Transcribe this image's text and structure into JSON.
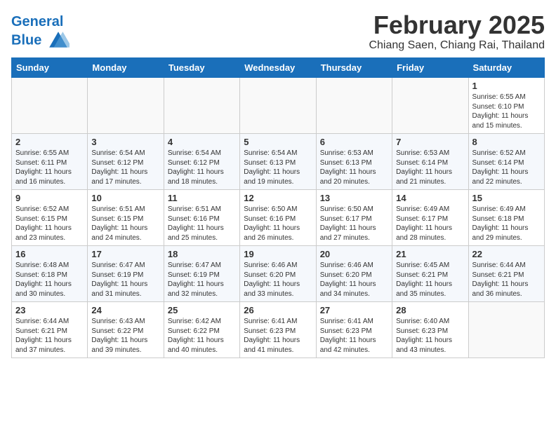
{
  "header": {
    "logo_line1": "General",
    "logo_line2": "Blue",
    "month_year": "February 2025",
    "location": "Chiang Saen, Chiang Rai, Thailand"
  },
  "columns": [
    "Sunday",
    "Monday",
    "Tuesday",
    "Wednesday",
    "Thursday",
    "Friday",
    "Saturday"
  ],
  "weeks": [
    [
      {
        "day": "",
        "info": ""
      },
      {
        "day": "",
        "info": ""
      },
      {
        "day": "",
        "info": ""
      },
      {
        "day": "",
        "info": ""
      },
      {
        "day": "",
        "info": ""
      },
      {
        "day": "",
        "info": ""
      },
      {
        "day": "1",
        "info": "Sunrise: 6:55 AM\nSunset: 6:10 PM\nDaylight: 11 hours\nand 15 minutes."
      }
    ],
    [
      {
        "day": "2",
        "info": "Sunrise: 6:55 AM\nSunset: 6:11 PM\nDaylight: 11 hours\nand 16 minutes."
      },
      {
        "day": "3",
        "info": "Sunrise: 6:54 AM\nSunset: 6:12 PM\nDaylight: 11 hours\nand 17 minutes."
      },
      {
        "day": "4",
        "info": "Sunrise: 6:54 AM\nSunset: 6:12 PM\nDaylight: 11 hours\nand 18 minutes."
      },
      {
        "day": "5",
        "info": "Sunrise: 6:54 AM\nSunset: 6:13 PM\nDaylight: 11 hours\nand 19 minutes."
      },
      {
        "day": "6",
        "info": "Sunrise: 6:53 AM\nSunset: 6:13 PM\nDaylight: 11 hours\nand 20 minutes."
      },
      {
        "day": "7",
        "info": "Sunrise: 6:53 AM\nSunset: 6:14 PM\nDaylight: 11 hours\nand 21 minutes."
      },
      {
        "day": "8",
        "info": "Sunrise: 6:52 AM\nSunset: 6:14 PM\nDaylight: 11 hours\nand 22 minutes."
      }
    ],
    [
      {
        "day": "9",
        "info": "Sunrise: 6:52 AM\nSunset: 6:15 PM\nDaylight: 11 hours\nand 23 minutes."
      },
      {
        "day": "10",
        "info": "Sunrise: 6:51 AM\nSunset: 6:15 PM\nDaylight: 11 hours\nand 24 minutes."
      },
      {
        "day": "11",
        "info": "Sunrise: 6:51 AM\nSunset: 6:16 PM\nDaylight: 11 hours\nand 25 minutes."
      },
      {
        "day": "12",
        "info": "Sunrise: 6:50 AM\nSunset: 6:16 PM\nDaylight: 11 hours\nand 26 minutes."
      },
      {
        "day": "13",
        "info": "Sunrise: 6:50 AM\nSunset: 6:17 PM\nDaylight: 11 hours\nand 27 minutes."
      },
      {
        "day": "14",
        "info": "Sunrise: 6:49 AM\nSunset: 6:17 PM\nDaylight: 11 hours\nand 28 minutes."
      },
      {
        "day": "15",
        "info": "Sunrise: 6:49 AM\nSunset: 6:18 PM\nDaylight: 11 hours\nand 29 minutes."
      }
    ],
    [
      {
        "day": "16",
        "info": "Sunrise: 6:48 AM\nSunset: 6:18 PM\nDaylight: 11 hours\nand 30 minutes."
      },
      {
        "day": "17",
        "info": "Sunrise: 6:47 AM\nSunset: 6:19 PM\nDaylight: 11 hours\nand 31 minutes."
      },
      {
        "day": "18",
        "info": "Sunrise: 6:47 AM\nSunset: 6:19 PM\nDaylight: 11 hours\nand 32 minutes."
      },
      {
        "day": "19",
        "info": "Sunrise: 6:46 AM\nSunset: 6:20 PM\nDaylight: 11 hours\nand 33 minutes."
      },
      {
        "day": "20",
        "info": "Sunrise: 6:46 AM\nSunset: 6:20 PM\nDaylight: 11 hours\nand 34 minutes."
      },
      {
        "day": "21",
        "info": "Sunrise: 6:45 AM\nSunset: 6:21 PM\nDaylight: 11 hours\nand 35 minutes."
      },
      {
        "day": "22",
        "info": "Sunrise: 6:44 AM\nSunset: 6:21 PM\nDaylight: 11 hours\nand 36 minutes."
      }
    ],
    [
      {
        "day": "23",
        "info": "Sunrise: 6:44 AM\nSunset: 6:21 PM\nDaylight: 11 hours\nand 37 minutes."
      },
      {
        "day": "24",
        "info": "Sunrise: 6:43 AM\nSunset: 6:22 PM\nDaylight: 11 hours\nand 39 minutes."
      },
      {
        "day": "25",
        "info": "Sunrise: 6:42 AM\nSunset: 6:22 PM\nDaylight: 11 hours\nand 40 minutes."
      },
      {
        "day": "26",
        "info": "Sunrise: 6:41 AM\nSunset: 6:23 PM\nDaylight: 11 hours\nand 41 minutes."
      },
      {
        "day": "27",
        "info": "Sunrise: 6:41 AM\nSunset: 6:23 PM\nDaylight: 11 hours\nand 42 minutes."
      },
      {
        "day": "28",
        "info": "Sunrise: 6:40 AM\nSunset: 6:23 PM\nDaylight: 11 hours\nand 43 minutes."
      },
      {
        "day": "",
        "info": ""
      }
    ]
  ]
}
